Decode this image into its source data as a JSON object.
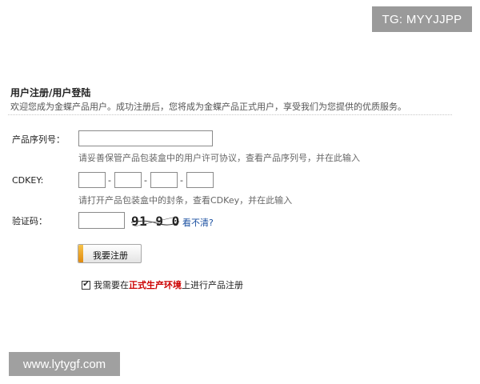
{
  "watermarks": {
    "top": "TG: MYYJJPP",
    "bottom": "www.lytygf.com"
  },
  "header": {
    "title": "用户注册/用户登陆",
    "subtitle": "欢迎您成为金蝶产品用户。成功注册后，您将成为金蝶产品正式用户，享受我们为您提供的优质服务。"
  },
  "form": {
    "serial": {
      "label": "产品序列号：",
      "value": "",
      "hint": "请妥善保管产品包装盒中的用户许可协议，查看产品序列号，并在此输入"
    },
    "cdkey": {
      "label": "CDKEY:",
      "separator": "-",
      "parts": [
        "",
        "",
        "",
        ""
      ],
      "hint": "请打开产品包装盒中的封条，查看CDKey，并在此输入"
    },
    "captcha": {
      "label": "验证码：",
      "value": "",
      "image_text": "91 9 0",
      "unclear_link": "看不清?"
    },
    "register_button": "我要注册",
    "agree": {
      "checked": true,
      "check_mark": "✔",
      "prefix": "我需要在",
      "highlight": "正式生产环境",
      "suffix": "上进行产品注册",
      "highlight_color": "#cc0000"
    }
  }
}
